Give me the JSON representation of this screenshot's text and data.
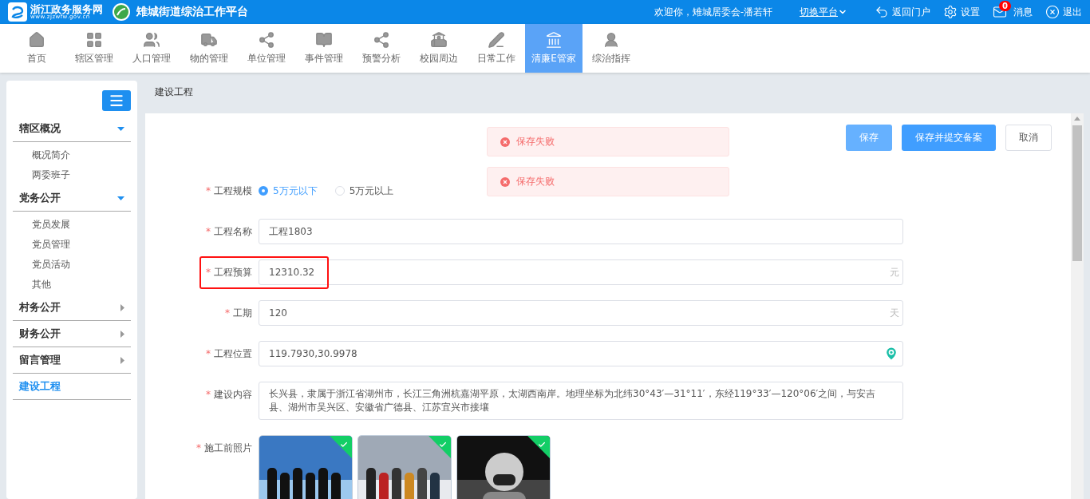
{
  "header": {
    "portal_name": "浙江政务服务网",
    "portal_url": "www.zjzwfw.gov.cn",
    "platform_title": "雉城街道综治工作平台",
    "welcome": "欢迎你，雉城居委会-潘若轩",
    "switch_platform": "切换平台",
    "links": [
      {
        "kind": "back",
        "label": "返回门户"
      },
      {
        "kind": "settings",
        "label": "设置"
      },
      {
        "kind": "mail",
        "label": "消息",
        "badge": "0"
      },
      {
        "kind": "logout",
        "label": "退出"
      }
    ]
  },
  "nav": [
    {
      "kind": "home",
      "label": "首页",
      "selected": false
    },
    {
      "kind": "grid",
      "label": "辖区管理",
      "selected": false
    },
    {
      "kind": "users",
      "label": "人口管理",
      "selected": false
    },
    {
      "kind": "truck",
      "label": "物的管理",
      "selected": false
    },
    {
      "kind": "network",
      "label": "单位管理",
      "selected": false
    },
    {
      "kind": "book",
      "label": "事件管理",
      "selected": false
    },
    {
      "kind": "network",
      "label": "预警分析",
      "selected": false
    },
    {
      "kind": "school",
      "label": "校园周边",
      "selected": false
    },
    {
      "kind": "pen",
      "label": "日常工作",
      "selected": false
    },
    {
      "kind": "landmark",
      "label": "清廉E管家",
      "selected": true
    },
    {
      "kind": "officer",
      "label": "综治指挥",
      "selected": false
    }
  ],
  "sidebar": {
    "groups": [
      {
        "label": "辖区概况",
        "expanded": true,
        "selected": false,
        "children": [
          {
            "label": "概况简介"
          },
          {
            "label": "两委班子"
          }
        ]
      },
      {
        "label": "党务公开",
        "expanded": true,
        "selected": false,
        "children": [
          {
            "label": "党员发展"
          },
          {
            "label": "党员管理"
          },
          {
            "label": "党员活动"
          },
          {
            "label": "其他"
          }
        ]
      },
      {
        "label": "村务公开",
        "expanded": false,
        "selected": false
      },
      {
        "label": "财务公开",
        "expanded": false,
        "selected": false
      },
      {
        "label": "留言管理",
        "expanded": false,
        "selected": false
      },
      {
        "label": "建设工程",
        "selected": true
      }
    ]
  },
  "breadcrumb": "建设工程",
  "alerts": [
    {
      "message": "保存失败"
    },
    {
      "message": "保存失败"
    }
  ],
  "actions": [
    {
      "label": "保存",
      "kind": "primary",
      "disabled": true
    },
    {
      "label": "保存并提交备案",
      "kind": "primary",
      "disabled": false
    },
    {
      "label": "取消",
      "kind": "default",
      "disabled": false
    }
  ],
  "form": [
    {
      "kind": "radio",
      "label": "工程规模",
      "required_mark": "*",
      "options": [
        {
          "label": "5万元以下",
          "selected": true
        },
        {
          "label": "5万元以上",
          "selected": false
        }
      ]
    },
    {
      "kind": "input",
      "label": "工程名称",
      "required_mark": "*",
      "value": "工程1803",
      "highlighted": false
    },
    {
      "kind": "input",
      "label": "工程预算",
      "required_mark": "*",
      "value": "12310.32",
      "suffix": "元",
      "highlighted": true
    },
    {
      "kind": "input",
      "label": "工期",
      "required_mark": "*",
      "value": "120",
      "suffix": "天",
      "highlighted": false
    },
    {
      "kind": "location",
      "label": "工程位置",
      "required_mark": "*",
      "value": "119.7930,30.9978",
      "highlighted": false
    },
    {
      "kind": "textarea",
      "label": "建设内容",
      "required_mark": "*",
      "value": "长兴县，隶属于浙江省湖州市，长江三角洲杭嘉湖平原，太湖西南岸。地理坐标为北纬30°43′—31°11′，东经119°33′—120°06′之间，与安吉县、湖州市吴兴区、安徽省广德县、江苏宜兴市接壤"
    },
    {
      "kind": "photos",
      "label": "施工前照片",
      "required_mark": "*",
      "photos": [
        {
          "kind": "picture",
          "uploaded": true
        },
        {
          "kind": "picture",
          "uploaded": true
        },
        {
          "kind": "picture",
          "uploaded": true
        }
      ]
    }
  ]
}
